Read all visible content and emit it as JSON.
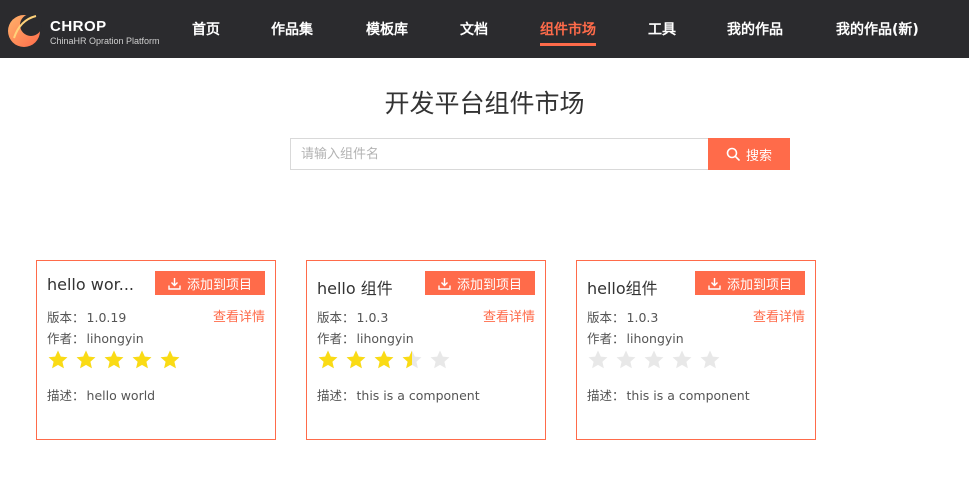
{
  "header": {
    "logo_title": "CHROP",
    "logo_subtitle": "ChinaHR Opration Platform",
    "nav": [
      {
        "label": "首页",
        "active": false
      },
      {
        "label": "作品集",
        "active": false
      },
      {
        "label": "模板库",
        "active": false
      },
      {
        "label": "文档",
        "active": false
      },
      {
        "label": "组件市场",
        "active": true
      },
      {
        "label": "工具",
        "active": false
      },
      {
        "label": "我的作品",
        "active": false
      },
      {
        "label": "我的作品(新)",
        "active": false
      }
    ]
  },
  "page": {
    "title": "开发平台组件市场"
  },
  "search": {
    "placeholder": "请输入组件名",
    "value": "",
    "button_label": "搜索"
  },
  "colors": {
    "accent": "#ff6b4a",
    "header_bg": "#2b2b2e",
    "star_filled": "#fadb14",
    "star_empty": "#e8e8e8"
  },
  "cards": [
    {
      "name": "hello wor...",
      "add_label": "添加到项目",
      "detail_label": "查看详情",
      "version_label": "版本：",
      "version": "1.0.19",
      "author_label": "作者：",
      "author": "lihongyin",
      "rating": 5,
      "desc_label": "描述：",
      "desc": "hello world"
    },
    {
      "name": "hello 组件",
      "add_label": "添加到项目",
      "detail_label": "查看详情",
      "version_label": "版本：",
      "version": "1.0.3",
      "author_label": "作者：",
      "author": "lihongyin",
      "rating": 3.5,
      "desc_label": "描述：",
      "desc": "this is a component"
    },
    {
      "name": "hello组件",
      "add_label": "添加到项目",
      "detail_label": "查看详情",
      "version_label": "版本：",
      "version": "1.0.3",
      "author_label": "作者：",
      "author": "lihongyin",
      "rating": 0,
      "desc_label": "描述：",
      "desc": "this is a component"
    }
  ]
}
